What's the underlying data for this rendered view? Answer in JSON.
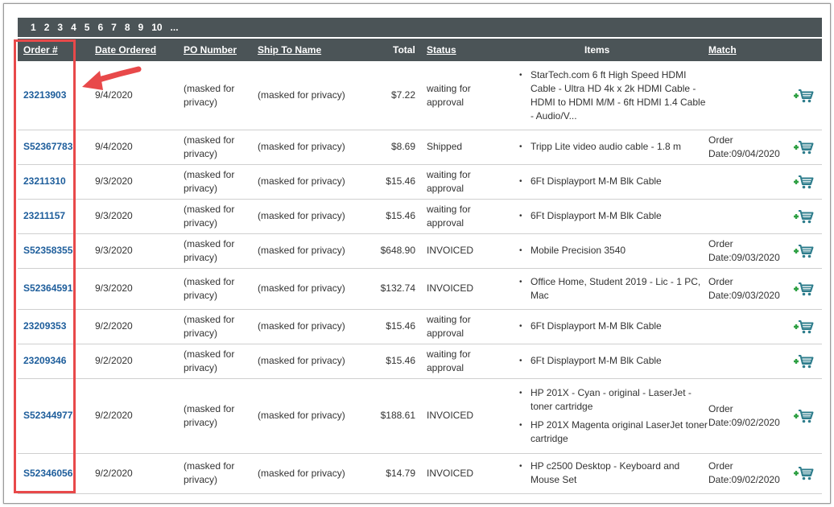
{
  "pager": {
    "pages": [
      "1",
      "2",
      "3",
      "4",
      "5",
      "6",
      "7",
      "8",
      "9",
      "10",
      "..."
    ]
  },
  "headers": {
    "order": "Order #",
    "date": "Date Ordered",
    "po": "PO Number",
    "ship": "Ship To Name",
    "total": "Total",
    "status": "Status",
    "items": "Items",
    "match": "Match"
  },
  "rows": [
    {
      "order": "23213903",
      "date": "9/4/2020",
      "po": "(masked for privacy)",
      "ship": "(masked for privacy)",
      "total": "$7.22",
      "status": "waiting for approval",
      "items": [
        "StarTech.com 6 ft High Speed HDMI Cable - Ultra HD 4k x 2k HDMI Cable - HDMI to HDMI M/M - 6ft HDMI 1.4 Cable - Audio/V..."
      ],
      "match": ""
    },
    {
      "order": "S52367783",
      "date": "9/4/2020",
      "po": "(masked for privacy)",
      "ship": "(masked for privacy)",
      "total": "$8.69",
      "status": "Shipped",
      "items": [
        "Tripp Lite video audio cable - 1.8 m"
      ],
      "match": "Order Date:09/04/2020"
    },
    {
      "order": "23211310",
      "date": "9/3/2020",
      "po": "(masked for privacy)",
      "ship": "(masked for privacy)",
      "total": "$15.46",
      "status": "waiting for approval",
      "items": [
        "6Ft Displayport M-M Blk Cable"
      ],
      "match": ""
    },
    {
      "order": "23211157",
      "date": "9/3/2020",
      "po": "(masked for privacy)",
      "ship": "(masked for privacy)",
      "total": "$15.46",
      "status": "waiting for approval",
      "items": [
        "6Ft Displayport M-M Blk Cable"
      ],
      "match": ""
    },
    {
      "order": "S52358355",
      "date": "9/3/2020",
      "po": "(masked for privacy)",
      "ship": "(masked for privacy)",
      "total": "$648.90",
      "status": "INVOICED",
      "items": [
        "Mobile Precision 3540"
      ],
      "match": "Order Date:09/03/2020"
    },
    {
      "order": "S52364591",
      "date": "9/3/2020",
      "po": "(masked for privacy)",
      "ship": "(masked for privacy)",
      "total": "$132.74",
      "status": "INVOICED",
      "items": [
        "Office Home, Student 2019 - Lic - 1 PC, Mac"
      ],
      "match": "Order Date:09/03/2020"
    },
    {
      "order": "23209353",
      "date": "9/2/2020",
      "po": "(masked for privacy)",
      "ship": "(masked for privacy)",
      "total": "$15.46",
      "status": "waiting for approval",
      "items": [
        "6Ft Displayport M-M Blk Cable"
      ],
      "match": ""
    },
    {
      "order": "23209346",
      "date": "9/2/2020",
      "po": "(masked for privacy)",
      "ship": "(masked for privacy)",
      "total": "$15.46",
      "status": "waiting for approval",
      "items": [
        "6Ft Displayport M-M Blk Cable"
      ],
      "match": ""
    },
    {
      "order": "S52344977",
      "date": "9/2/2020",
      "po": "(masked for privacy)",
      "ship": "(masked for privacy)",
      "total": "$188.61",
      "status": "INVOICED",
      "items": [
        "HP 201X - Cyan - original - LaserJet - toner cartridge",
        "HP 201X Magenta original LaserJet toner cartridge"
      ],
      "match": "Order Date:09/02/2020"
    },
    {
      "order": "S52346056",
      "date": "9/2/2020",
      "po": "(masked for privacy)",
      "ship": "(masked for privacy)",
      "total": "$14.79",
      "status": "INVOICED",
      "items": [
        "HP c2500 Desktop - Keyboard and Mouse Set"
      ],
      "match": "Order Date:09/02/2020"
    }
  ],
  "icons": {
    "cart": "add-to-cart-icon",
    "arrow": "red-arrow-annotation"
  },
  "colors": {
    "header_bg": "#4b5457",
    "link": "#1d5d9b",
    "highlight": "#e8494a",
    "cart_icon": "#2e8b57"
  }
}
